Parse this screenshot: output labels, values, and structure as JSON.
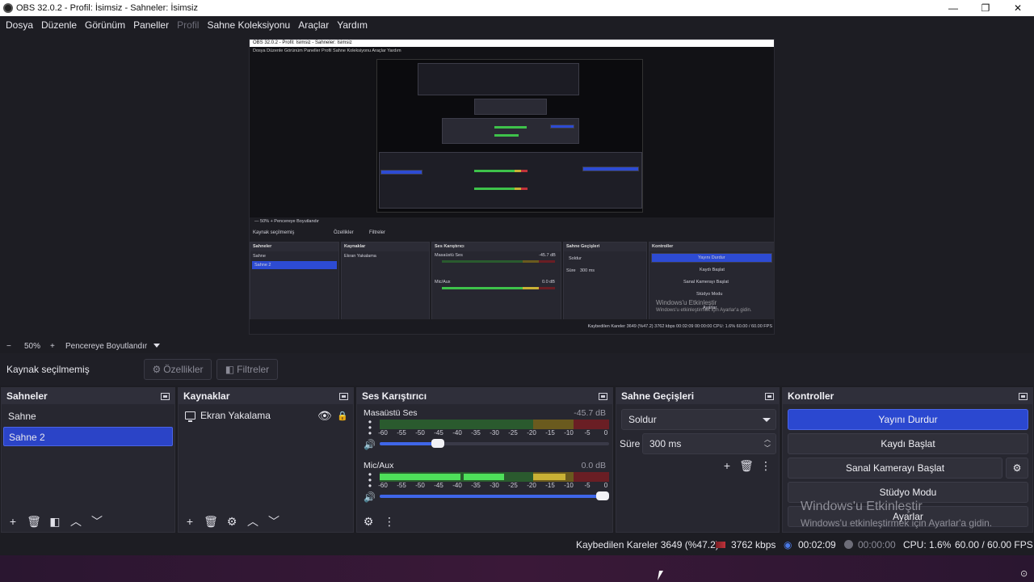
{
  "window": {
    "title": "OBS 32.0.2 - Profil: İsimsiz - Sahneler: İsimsiz",
    "minimize": "—",
    "maximize": "❐",
    "close": "✕"
  },
  "menu": [
    "Dosya",
    "Düzenle",
    "Görünüm",
    "Paneller",
    "Profil",
    "Sahne Koleksiyonu",
    "Araçlar",
    "Yardım"
  ],
  "menu_disabled": [
    "Profil"
  ],
  "preview": {
    "nested_title": "OBS 32.0.2 - Profil: İsimsiz - Sahneler: İsimsiz",
    "nested_menu": "Dosya   Düzenle   Görünüm   Paneller   Profil   Sahne Koleksiyonu   Araçlar   Yardım",
    "nested_zoom": "—  50%  +  Pencereye Boyutlandır",
    "nested_nosel": "Kaynak seçilmemiş",
    "nested_props": "Özellikler",
    "nested_filters": "Filtreler",
    "nested_docks": [
      "Sahneler",
      "Kaynaklar",
      "Ses Karıştırıcı",
      "Sahne Geçişleri",
      "Kontroller"
    ],
    "nested_scenes": [
      "Sahne",
      "Sahne 2"
    ],
    "nested_source": "Ekran Yakalama",
    "nested_ch1": "Masaüstü Ses",
    "nested_ch1_db": "-45.7 dB",
    "nested_ch2": "Mic/Aux",
    "nested_ch2_db": "0.0 dB",
    "nested_transition": "Soldur",
    "nested_duration_label": "Süre",
    "nested_duration": "300 ms",
    "nested_controls": [
      "Yayını Durdur",
      "Kaydı Başlat",
      "Sanal Kamerayı Başlat",
      "Stüdyo Modu",
      "Ayarlar"
    ],
    "nested_watermark1": "Windows'u Etkinleştir",
    "nested_watermark2": "Windows'u etkinleştirmek için Ayarlar'a gidin.",
    "nested_status": "Kaybedilen Kareler 3649 (%47.2)     3762 kbps     00:02:09     00:00:00     CPU: 1.6%     60.00 / 60.00 FPS"
  },
  "zoom": {
    "minus": "−",
    "level": "50%",
    "plus": "+",
    "fit": "Pencereye Boyutlandır"
  },
  "source_toolbar": {
    "no_selection": "Kaynak seçilmemiş",
    "properties": "Özellikler",
    "filters": "Filtreler"
  },
  "scenes": {
    "title": "Sahneler",
    "items": [
      "Sahne",
      "Sahne 2"
    ],
    "selected_index": 1
  },
  "sources": {
    "title": "Kaynaklar",
    "items": [
      {
        "name": "Ekran Yakalama",
        "visible": true,
        "locked": false
      }
    ]
  },
  "mixer": {
    "title": "Ses Karıştırıcı",
    "scale": [
      "-60",
      "-55",
      "-50",
      "-45",
      "-40",
      "-35",
      "-30",
      "-25",
      "-20",
      "-15",
      "-10",
      "-5",
      "0"
    ],
    "channels": [
      {
        "name": "Masaüstü Ses",
        "db": "-45.7 dB",
        "level": 0.0,
        "volume": 0.25
      },
      {
        "name": "Mic/Aux",
        "db": "0.0 dB",
        "level": 0.78,
        "volume": 1.0
      }
    ]
  },
  "transitions": {
    "title": "Sahne Geçişleri",
    "selected": "Soldur",
    "duration_label": "Süre",
    "duration": "300 ms"
  },
  "controls": {
    "title": "Kontroller",
    "stop_stream": "Yayını Durdur",
    "start_record": "Kaydı Başlat",
    "start_virtual_cam": "Sanal Kamerayı Başlat",
    "studio_mode": "Stüdyo Modu",
    "settings": "Ayarlar"
  },
  "watermark": {
    "line1": "Windows'u Etkinleştir",
    "line2": "Windows'u etkinleştirmek için Ayarlar'a gidin."
  },
  "status": {
    "dropped_frames": "Kaybedilen Kareler 3649 (%47.2)",
    "bitrate": "3762 kbps",
    "stream_time": "00:02:09",
    "record_time": "00:00:00",
    "cpu": "CPU: 1.6%",
    "fps": "60.00 / 60.00 FPS"
  },
  "colors": {
    "accent": "#2b48d0",
    "background": "#1d1d23",
    "dock": "#272730",
    "meter_green": "#4ee05a",
    "meter_yellow": "#c9b135",
    "meter_red": "#c0323a"
  }
}
